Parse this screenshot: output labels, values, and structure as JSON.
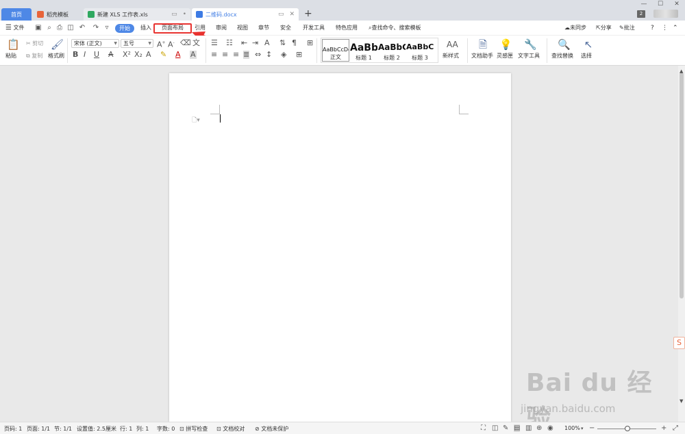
{
  "tabs": {
    "home": "首页",
    "template": "稻壳模板",
    "xls": "新建 XLS 工作表.xls",
    "docx": "二维码.docx",
    "new_tab": "+"
  },
  "window": {
    "minimize": "—",
    "maximize": "☐",
    "close": "✕",
    "badge": "2"
  },
  "menu": {
    "file": "文件",
    "start": "开始",
    "items": [
      "插入",
      "页面布局",
      "引用",
      "审阅",
      "视图",
      "章节",
      "安全",
      "开发工具",
      "特色应用"
    ],
    "search": "查找命令、搜索模板",
    "sync": "未同步",
    "share": "分享",
    "comment": "批注",
    "help": "?",
    "more": "⋮"
  },
  "ribbon": {
    "paste": "粘贴",
    "cut": "剪切",
    "copy": "复制",
    "format_painter": "格式刷",
    "font_name": "宋体 (正文)",
    "font_size": "五号",
    "styles": [
      {
        "sample": "AaBbCcDd",
        "name": "正文"
      },
      {
        "sample": "AaBb",
        "name": "标题 1"
      },
      {
        "sample": "AaBbC",
        "name": "标题 2"
      },
      {
        "sample": "AaBbC",
        "name": "标题 3"
      }
    ],
    "new_style": "新样式",
    "doc_assistant": "文档助手",
    "inspiration": "灵感匣",
    "text_tools": "文字工具",
    "find_replace": "查找替换",
    "select": "选择"
  },
  "status": {
    "page_code": "页码: 1",
    "page": "页面: 1/1",
    "section": "节: 1/1",
    "setting": "设置值: 2.5厘米",
    "row": "行: 1",
    "col": "列: 1",
    "words": "字数: 0",
    "spell": "拼写检查",
    "proof": "文档校对",
    "protect": "文档未保护",
    "zoom": "100%"
  },
  "watermark": {
    "brand": "Bai du 经验",
    "url": "jingyan.baidu.com"
  },
  "colors": {
    "accent": "#4e88e6",
    "highlight": "#e8322f"
  }
}
